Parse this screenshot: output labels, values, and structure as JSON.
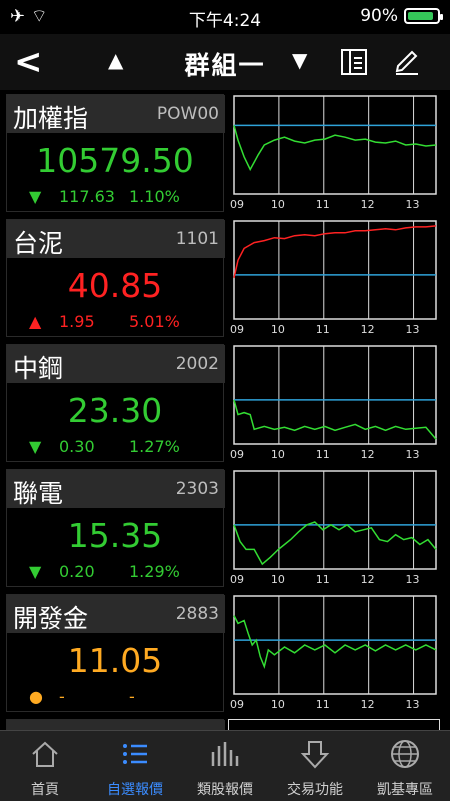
{
  "status": {
    "time": "下午4:24",
    "battery": "90%",
    "battery_level": 0.9
  },
  "nav": {
    "back": "<",
    "up_arrow": "▲",
    "title": "群組一",
    "down_arrow": "▼",
    "icons": [
      "back-icon",
      "layout-icon",
      "edit-icon"
    ]
  },
  "stocks": [
    {
      "name": "加權指",
      "code": "POW00",
      "price": "10579.50",
      "arrow": "▼",
      "change": "117.63",
      "pct": "1.10%",
      "tone": "green",
      "chart": {
        "ref": 0.3,
        "line_color": "#33dd33",
        "line": [
          [
            0,
            0.3
          ],
          [
            0.02,
            0.45
          ],
          [
            0.05,
            0.62
          ],
          [
            0.08,
            0.75
          ],
          [
            0.12,
            0.6
          ],
          [
            0.15,
            0.5
          ],
          [
            0.2,
            0.45
          ],
          [
            0.25,
            0.42
          ],
          [
            0.3,
            0.46
          ],
          [
            0.35,
            0.48
          ],
          [
            0.4,
            0.45
          ],
          [
            0.45,
            0.44
          ],
          [
            0.5,
            0.4
          ],
          [
            0.55,
            0.42
          ],
          [
            0.6,
            0.45
          ],
          [
            0.65,
            0.44
          ],
          [
            0.7,
            0.47
          ],
          [
            0.75,
            0.48
          ],
          [
            0.8,
            0.46
          ],
          [
            0.85,
            0.5
          ],
          [
            0.9,
            0.49
          ],
          [
            0.95,
            0.51
          ],
          [
            1,
            0.5
          ]
        ]
      }
    },
    {
      "name": "台泥",
      "code": "1101",
      "price": "40.85",
      "arrow": "▲",
      "change": "1.95",
      "pct": "5.01%",
      "tone": "red",
      "chart": {
        "ref": 0.55,
        "line_color": "#ff2222",
        "line": [
          [
            0,
            0.58
          ],
          [
            0.02,
            0.4
          ],
          [
            0.05,
            0.28
          ],
          [
            0.1,
            0.22
          ],
          [
            0.15,
            0.2
          ],
          [
            0.2,
            0.17
          ],
          [
            0.25,
            0.18
          ],
          [
            0.3,
            0.15
          ],
          [
            0.35,
            0.14
          ],
          [
            0.4,
            0.15
          ],
          [
            0.45,
            0.13
          ],
          [
            0.5,
            0.12
          ],
          [
            0.55,
            0.12
          ],
          [
            0.6,
            0.1
          ],
          [
            0.65,
            0.1
          ],
          [
            0.7,
            0.09
          ],
          [
            0.75,
            0.08
          ],
          [
            0.8,
            0.09
          ],
          [
            0.85,
            0.07
          ],
          [
            0.9,
            0.06
          ],
          [
            0.95,
            0.06
          ],
          [
            1,
            0.05
          ]
        ]
      }
    },
    {
      "name": "中鋼",
      "code": "2002",
      "price": "23.30",
      "arrow": "▼",
      "change": "0.30",
      "pct": "1.27%",
      "tone": "green",
      "chart": {
        "ref": 0.55,
        "line_color": "#33dd33",
        "line": [
          [
            0,
            0.55
          ],
          [
            0.02,
            0.7
          ],
          [
            0.05,
            0.68
          ],
          [
            0.08,
            0.7
          ],
          [
            0.1,
            0.85
          ],
          [
            0.15,
            0.82
          ],
          [
            0.2,
            0.85
          ],
          [
            0.25,
            0.83
          ],
          [
            0.3,
            0.86
          ],
          [
            0.35,
            0.82
          ],
          [
            0.4,
            0.85
          ],
          [
            0.45,
            0.82
          ],
          [
            0.5,
            0.86
          ],
          [
            0.55,
            0.83
          ],
          [
            0.6,
            0.8
          ],
          [
            0.65,
            0.85
          ],
          [
            0.7,
            0.82
          ],
          [
            0.75,
            0.86
          ],
          [
            0.8,
            0.82
          ],
          [
            0.85,
            0.85
          ],
          [
            0.9,
            0.84
          ],
          [
            0.95,
            0.83
          ],
          [
            1,
            0.95
          ]
        ]
      }
    },
    {
      "name": "聯電",
      "code": "2303",
      "price": "15.35",
      "arrow": "▼",
      "change": "0.20",
      "pct": "1.29%",
      "tone": "green",
      "chart": {
        "ref": 0.55,
        "line_color": "#33dd33",
        "line": [
          [
            0,
            0.55
          ],
          [
            0.03,
            0.72
          ],
          [
            0.06,
            0.8
          ],
          [
            0.1,
            0.8
          ],
          [
            0.14,
            0.95
          ],
          [
            0.18,
            0.88
          ],
          [
            0.22,
            0.8
          ],
          [
            0.25,
            0.75
          ],
          [
            0.28,
            0.7
          ],
          [
            0.32,
            0.62
          ],
          [
            0.36,
            0.55
          ],
          [
            0.4,
            0.52
          ],
          [
            0.44,
            0.6
          ],
          [
            0.48,
            0.55
          ],
          [
            0.52,
            0.6
          ],
          [
            0.56,
            0.55
          ],
          [
            0.6,
            0.62
          ],
          [
            0.64,
            0.6
          ],
          [
            0.68,
            0.58
          ],
          [
            0.72,
            0.7
          ],
          [
            0.76,
            0.72
          ],
          [
            0.8,
            0.65
          ],
          [
            0.84,
            0.7
          ],
          [
            0.88,
            0.68
          ],
          [
            0.92,
            0.75
          ],
          [
            0.96,
            0.7
          ],
          [
            1,
            0.8
          ]
        ]
      }
    },
    {
      "name": "開發金",
      "code": "2883",
      "price": "11.05",
      "arrow": "●",
      "change": "-",
      "pct": "-",
      "tone": "orange",
      "chart": {
        "ref": 0.45,
        "line_color": "#33dd33",
        "line": [
          [
            0,
            0.2
          ],
          [
            0.02,
            0.28
          ],
          [
            0.05,
            0.25
          ],
          [
            0.07,
            0.38
          ],
          [
            0.09,
            0.5
          ],
          [
            0.11,
            0.45
          ],
          [
            0.13,
            0.62
          ],
          [
            0.15,
            0.72
          ],
          [
            0.17,
            0.55
          ],
          [
            0.2,
            0.6
          ],
          [
            0.25,
            0.52
          ],
          [
            0.3,
            0.58
          ],
          [
            0.35,
            0.5
          ],
          [
            0.4,
            0.55
          ],
          [
            0.45,
            0.5
          ],
          [
            0.5,
            0.58
          ],
          [
            0.55,
            0.5
          ],
          [
            0.6,
            0.55
          ],
          [
            0.65,
            0.5
          ],
          [
            0.7,
            0.56
          ],
          [
            0.75,
            0.5
          ],
          [
            0.8,
            0.55
          ],
          [
            0.85,
            0.5
          ],
          [
            0.9,
            0.55
          ],
          [
            0.95,
            0.5
          ],
          [
            1,
            0.55
          ]
        ]
      }
    }
  ],
  "x_ticks": [
    "09",
    "10",
    "11",
    "12",
    "13"
  ],
  "tabs": [
    {
      "label": "首頁",
      "icon": "home-icon",
      "active": false
    },
    {
      "label": "自選報價",
      "icon": "list-icon",
      "active": true
    },
    {
      "label": "類股報價",
      "icon": "bar-chart-icon",
      "active": false
    },
    {
      "label": "交易功能",
      "icon": "trade-icon",
      "active": false
    },
    {
      "label": "凱基專區",
      "icon": "globe-icon",
      "active": false
    }
  ],
  "colors": {
    "green": "#33cc33",
    "red": "#ff2222",
    "orange": "#ffaa22",
    "ref_line": "#2fa3d9",
    "accent": "#3b8cff"
  }
}
